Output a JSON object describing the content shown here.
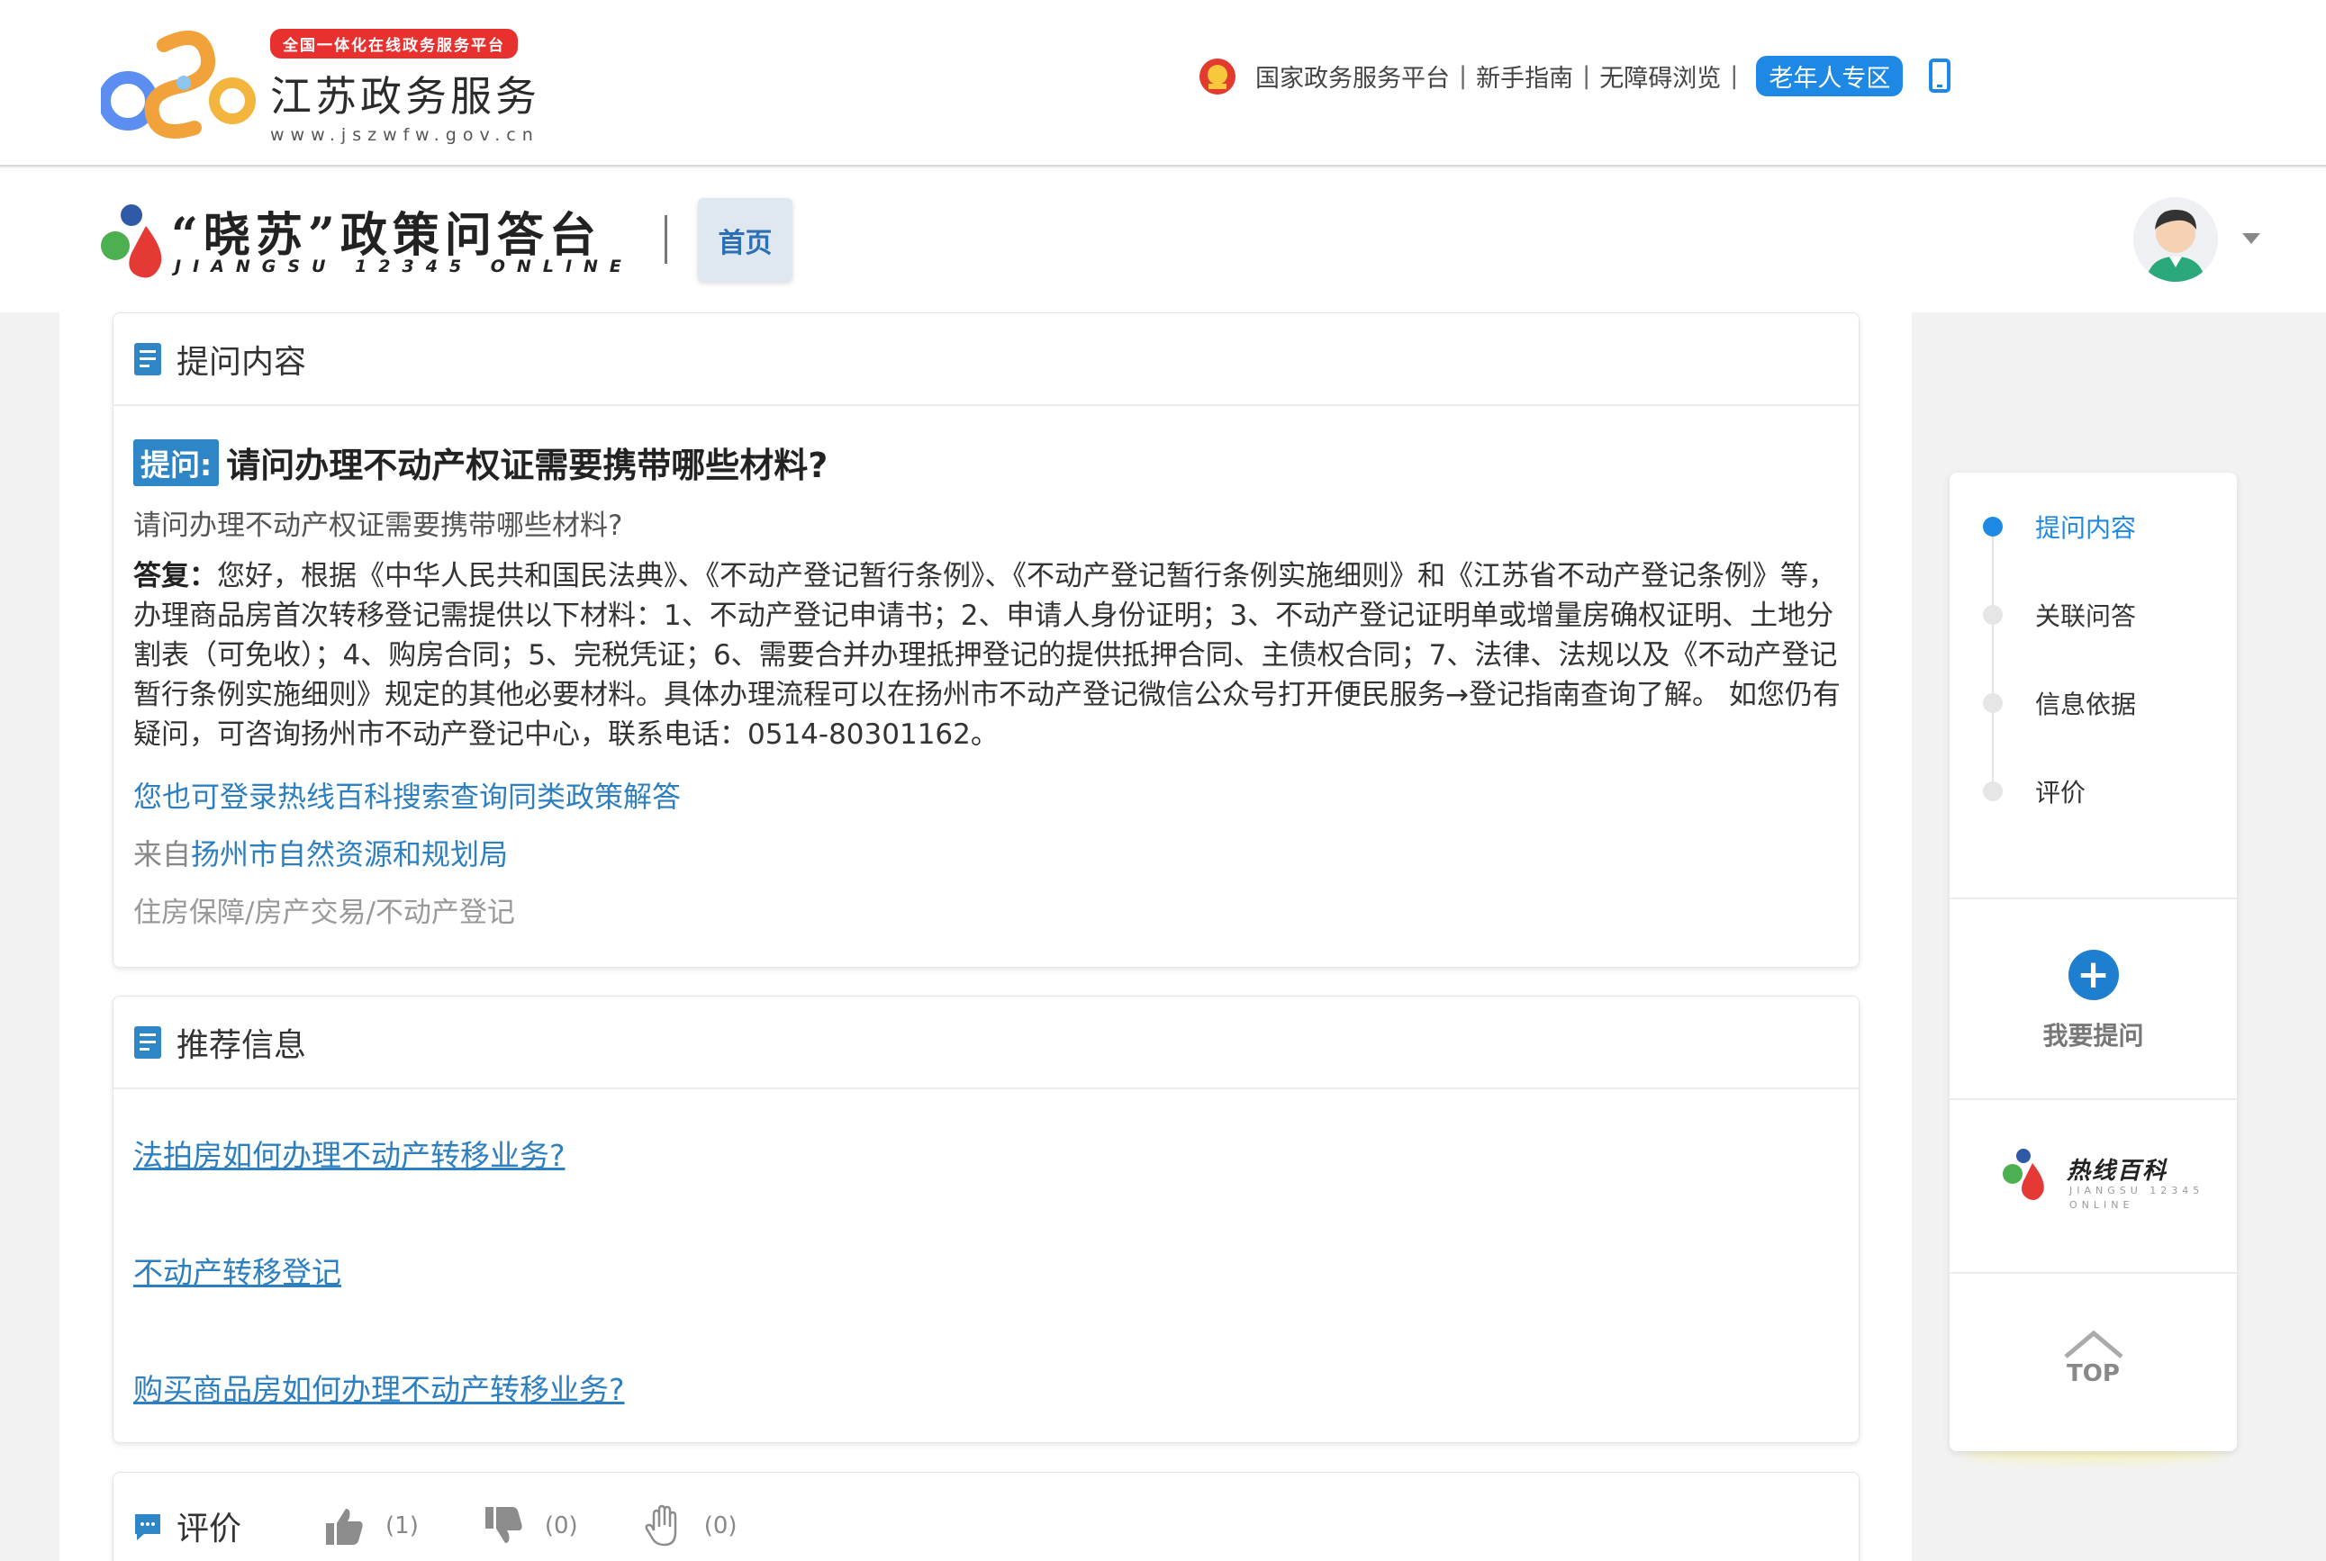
{
  "header": {
    "badge": "全国一体化在线政务服务平台",
    "site_title": "江苏政务服务",
    "site_url": "www.jszwfw.gov.cn",
    "links": {
      "national": "国家政务服务平台",
      "guide": "新手指南",
      "accessible": "无障碍浏览",
      "elder": "老年人专区"
    }
  },
  "nav": {
    "brand_title": "“晓苏”政策问答台",
    "brand_sub": "JIANGSU 12345 ONLINE",
    "home": "首页"
  },
  "question_card": {
    "heading": "提问内容",
    "badge": "提问:",
    "title": "请问办理不动产权证需要携带哪些材料?",
    "body": "请问办理不动产权证需要携带哪些材料?",
    "answer_label": "答复：",
    "answer_text": "您好，根据《中华人民共和国民法典》、《不动产登记暂行条例》、《不动产登记暂行条例实施细则》和《江苏省不动产登记条例》等，办理商品房首次转移登记需提供以下材料：1、不动产登记申请书；2、申请人身份证明；3、不动产登记证明单或增量房确权证明、土地分割表（可免收）；4、购房合同；5、完税凭证；6、需要合并办理抵押登记的提供抵押合同、主债权合同；7、法律、法规以及《不动产登记暂行条例实施细则》规定的其他必要材料。具体办理流程可以在扬州市不动产登记微信公众号打开便民服务→登记指南查询了解。 如您仍有疑问，可咨询扬州市不动产登记中心，联系电话：0514-80301162。",
    "baike_link": "您也可登录热线百科搜索查询同类政策解答",
    "from_prefix": "来自",
    "from_dept": "扬州市自然资源和规划局",
    "category": "住房保障/房产交易/不动产登记"
  },
  "recommend_card": {
    "heading": "推荐信息",
    "items": [
      "法拍房如何办理不动产转移业务? ",
      "不动产转移登记",
      "购买商品房如何办理不动产转移业务? "
    ]
  },
  "evaluation": {
    "heading": "评价",
    "like_count": "(1)",
    "dislike_count": "(0)",
    "hand_count": "(0)"
  },
  "side_panel": {
    "nav": [
      "提问内容",
      "关联问答",
      "信息依据",
      "评价"
    ],
    "ask_plus": "+",
    "ask": "我要提问",
    "baike_title": "热线百科",
    "baike_sub": "JIANGSU 12345 ONLINE",
    "top": "TOP"
  },
  "colors": {
    "accent": "#1e88e5",
    "link": "#2e7fc0",
    "badge_red": "#e8312f"
  }
}
